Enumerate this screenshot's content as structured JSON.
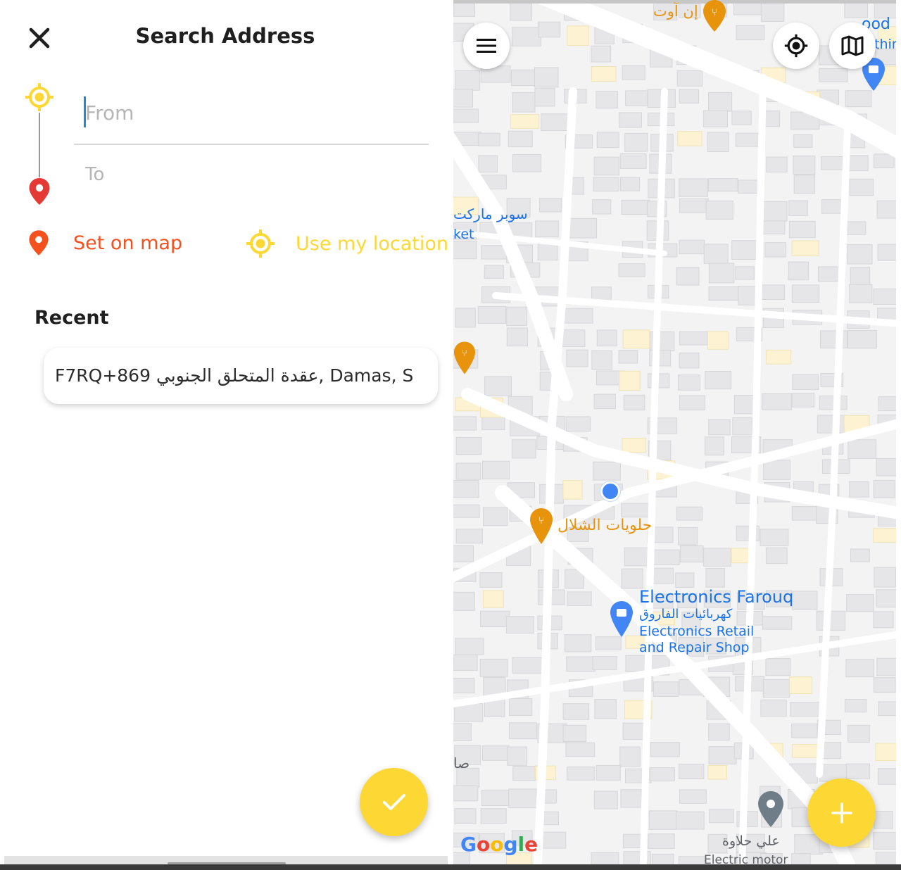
{
  "header": {
    "title": "Search Address",
    "close_icon": "close-icon"
  },
  "form": {
    "from_placeholder": "From",
    "to_placeholder": "To",
    "from_value": "",
    "to_value": ""
  },
  "actions": {
    "set_on_map": "Set on map",
    "use_my_location": "Use my location"
  },
  "recent": {
    "title": "Recent",
    "items": [
      {
        "label": "F7RQ+869 عقدة المتحلق الجنوبي, Damas, S"
      }
    ]
  },
  "colors": {
    "accent_yellow": "#fdd835",
    "accent_orange": "#f4511e",
    "pin_red": "#e53935",
    "map_poi_orange": "#e8930c",
    "map_poi_blue": "#1a73e8"
  },
  "map": {
    "labels": {
      "poi_top": "إن آوت",
      "poi_top_right_1": "ood",
      "poi_top_right_2": "thin",
      "market_ar": "سوبر ماركت",
      "market_en": "ket",
      "sweets": "حلويات الشلال",
      "shop_name": "Electronics Farouq",
      "shop_ar": "كهربائيات الفاروق",
      "shop_type_1": "Electronics Retail",
      "shop_type_2": "and Repair Shop",
      "left_edge": "صا",
      "bottom_ar": "علي حلاوة",
      "bottom_en": "Electric motor"
    },
    "google_logo": "Google",
    "menu_icon": "hamburger-menu-icon",
    "locate_icon": "my-location-icon",
    "layers_icon": "map-layers-icon",
    "add_icon": "plus-icon"
  },
  "fab": {
    "confirm_icon": "check-icon"
  }
}
